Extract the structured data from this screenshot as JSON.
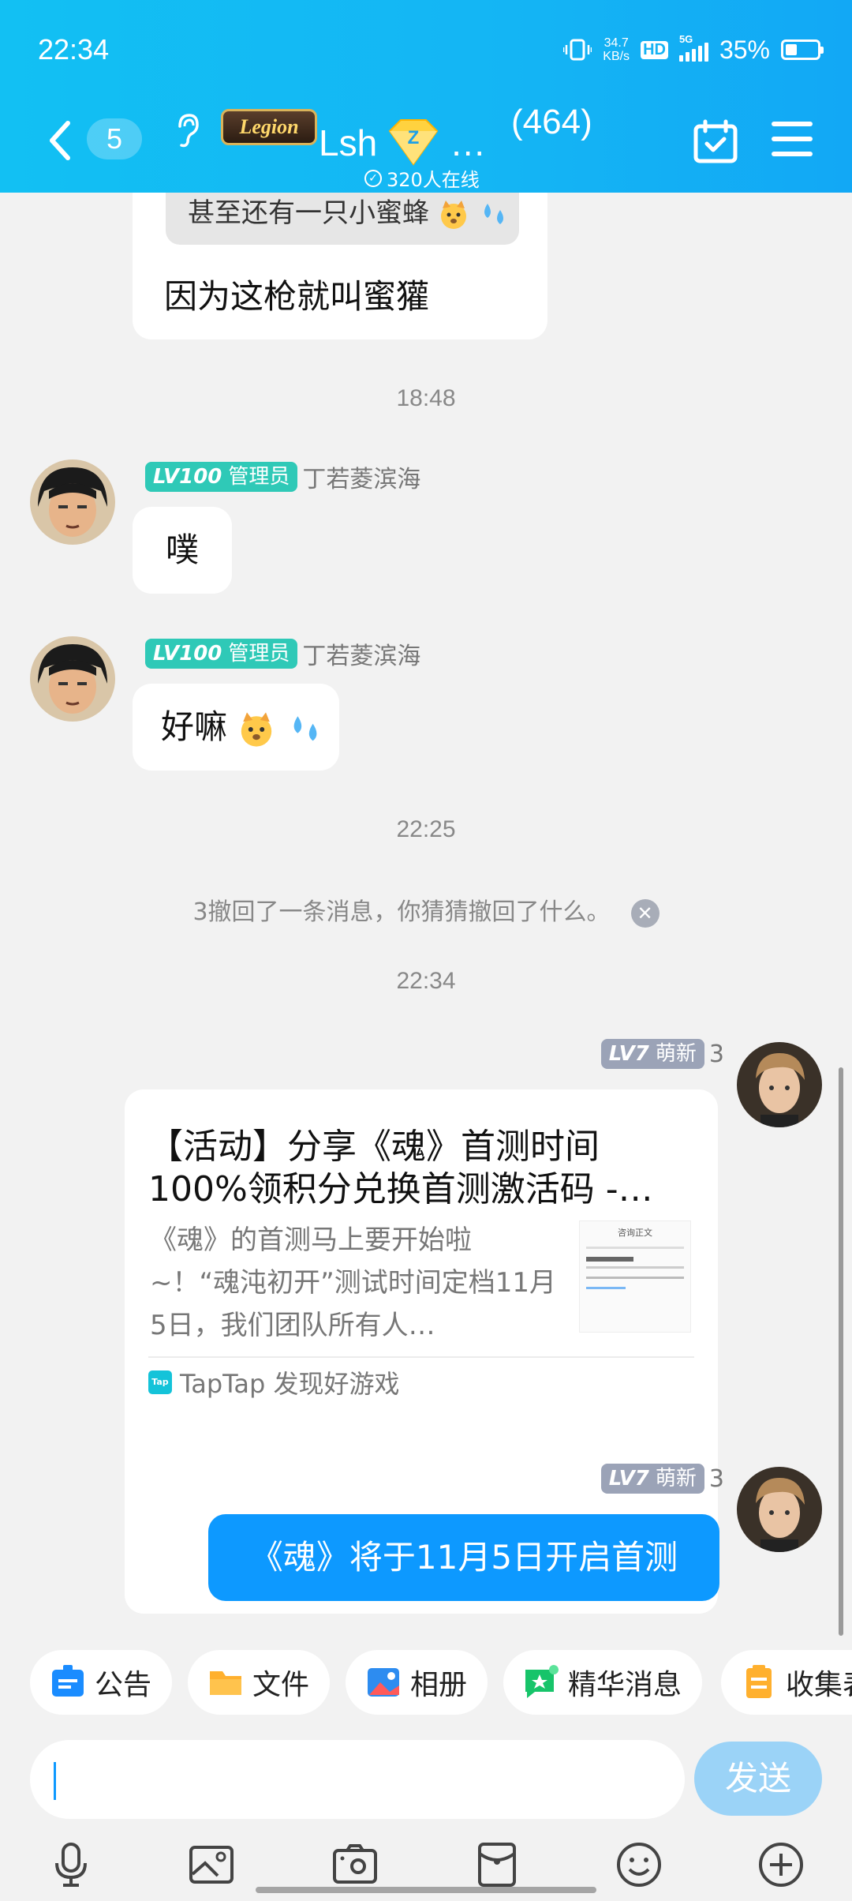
{
  "status_bar": {
    "time": "22:34",
    "net_speed_value": "34.7",
    "net_speed_unit": "KB/s",
    "hd": "HD",
    "network": "5G",
    "battery": "35%"
  },
  "header": {
    "back_count": "5",
    "group_badge": "Legion",
    "group_name": "Lsh",
    "ellipsis": "…",
    "member_count": "(464)",
    "online": "320人在线"
  },
  "messages": {
    "quote_text": "甚至还有一只小蜜蜂",
    "msg1": "因为这枪就叫蜜獾",
    "time1": "18:48",
    "admin_level": "LV100",
    "admin_role": "管理员",
    "admin_name": "丁若菱滨海",
    "msg2": "噗",
    "msg3": "好嘛",
    "time2": "22:25",
    "recall": "3撤回了一条消息，你猜猜撤回了什么。",
    "time3": "22:34",
    "me_level": "LV7",
    "me_role": "萌新",
    "me_name": "3",
    "card_title": "【活动】分享《魂》首测时间100%领积分兑换首测激活码 -…",
    "card_desc": "《魂》的首测马上要开始啦~！“魂沌初开”测试时间定档11月5日，我们团队所有人…",
    "card_thumb_title": "咨询正文",
    "card_source": "TapTap 发现好游戏",
    "card_logo": "Tap",
    "msg_last": "《魂》将于11月5日开启首测"
  },
  "quick_actions": [
    {
      "label": "公告",
      "icon": "announcement-icon",
      "color": "#1a8cff"
    },
    {
      "label": "文件",
      "icon": "folder-icon",
      "color": "#ffb02e"
    },
    {
      "label": "相册",
      "icon": "album-icon",
      "color": "#2d8cf0"
    },
    {
      "label": "精华消息",
      "icon": "essence-icon",
      "color": "#17c46a"
    },
    {
      "label": "收集表",
      "icon": "form-icon",
      "color": "#ffb02e"
    }
  ],
  "input": {
    "placeholder": "",
    "send": "发送"
  },
  "toolbar_icons": [
    "mic-icon",
    "image-icon",
    "camera-icon",
    "red-packet-icon",
    "emoji-icon",
    "plus-icon"
  ]
}
